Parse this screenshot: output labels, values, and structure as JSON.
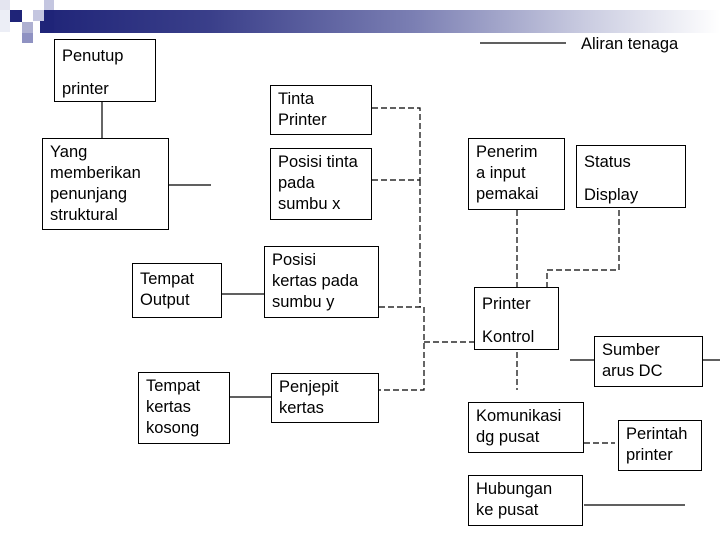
{
  "legend": {
    "solid_line_label": "Aliran tenaga"
  },
  "nodes": {
    "penutup_printer": "Penutup\nprinter",
    "struktural": "Yang\nmemberikan\npenunjang\nstruktural",
    "tempat_output": "Tempat\nOutput",
    "tempat_kertas_kosong": "Tempat\nkertas\nkosong",
    "tinta_printer": "Tinta\nPrinter",
    "posisi_tinta": "Posisi tinta\npada\nsumbu x",
    "posisi_kertas": "Posisi\nkertas pada\nsumbu y",
    "penjepit_kertas": "Penjepit\nkertas",
    "penerima_input": "Penerim\na input\npemakai",
    "status_display": "Status\nDisplay",
    "printer_kontrol": "Printer\nKontrol",
    "sumber_arus_dc": "Sumber\narus DC",
    "komunikasi_pusat": "Komunikasi\ndg pusat",
    "perintah_printer": "Perintah\nprinter",
    "hubungan_pusat": "Hubungan\nke pusat"
  },
  "colors": {
    "banner_dark": "#1f2478",
    "banner_mid": "#7b7fb3",
    "line": "#000000"
  }
}
